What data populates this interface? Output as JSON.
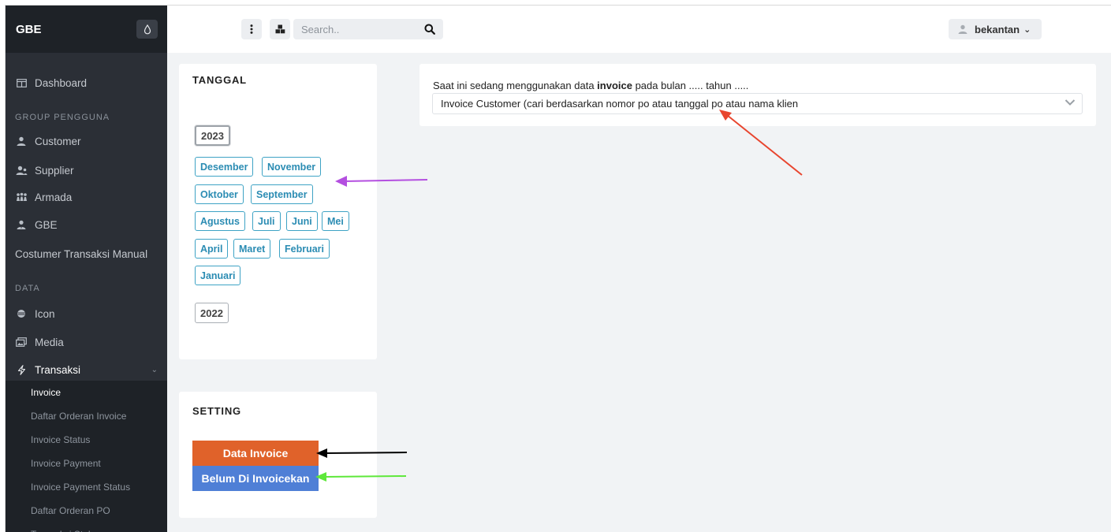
{
  "app": {
    "brand": "GBE"
  },
  "sidebar": {
    "items": [
      {
        "label": "Dashboard",
        "icon": "dashboard-icon"
      },
      {
        "label": "Customer",
        "icon": "user-icon"
      },
      {
        "label": "Supplier",
        "icon": "users-icon"
      },
      {
        "label": "Armada",
        "icon": "group-icon"
      },
      {
        "label": "GBE",
        "icon": "user-tie-icon"
      },
      {
        "label": "Costumer Transaksi Manual"
      },
      {
        "label": "Icon",
        "icon": "globe-icon"
      },
      {
        "label": "Media",
        "icon": "images-icon"
      },
      {
        "label": "Transaksi",
        "icon": "bolt-icon"
      }
    ],
    "headings": [
      "GROUP PENGGUNA",
      "DATA"
    ],
    "sub_items": [
      "Invoice",
      "Daftar Orderan Invoice",
      "Invoice Status",
      "Invoice Payment",
      "Invoice Payment Status",
      "Daftar Orderan PO",
      "Transaksi Stok"
    ]
  },
  "topbar": {
    "search_placeholder": "Search..",
    "user_name": "bekantan"
  },
  "tanggal": {
    "title": "TANGGAL",
    "years": [
      "2023",
      "2022"
    ],
    "months": [
      "Desember",
      "November",
      "Oktober",
      "September",
      "Agustus",
      "Juli",
      "Juni",
      "Mei",
      "April",
      "Maret",
      "Februari",
      "Januari"
    ]
  },
  "setting": {
    "title": "SETTING",
    "data_invoice_label": "Data Invoice",
    "belum_label": "Belum Di Invoicekan"
  },
  "info": {
    "text_before": "Saat ini sedang menggunakan data ",
    "text_bold": "invoice",
    "text_after": " pada bulan ..... tahun .....",
    "select_value": "Invoice Customer (cari berdasarkan nomor po atau tanggal po atau nama klien"
  },
  "colors": {
    "sidebar_bg": "#2b2f36",
    "accent_month": "#2b8cb3",
    "data_invoice_btn": "#e0622a",
    "belum_btn": "#4f7fd6",
    "arrow_purple": "#b44fe0",
    "arrow_red": "#e8452e",
    "arrow_green": "#5ee83a"
  }
}
